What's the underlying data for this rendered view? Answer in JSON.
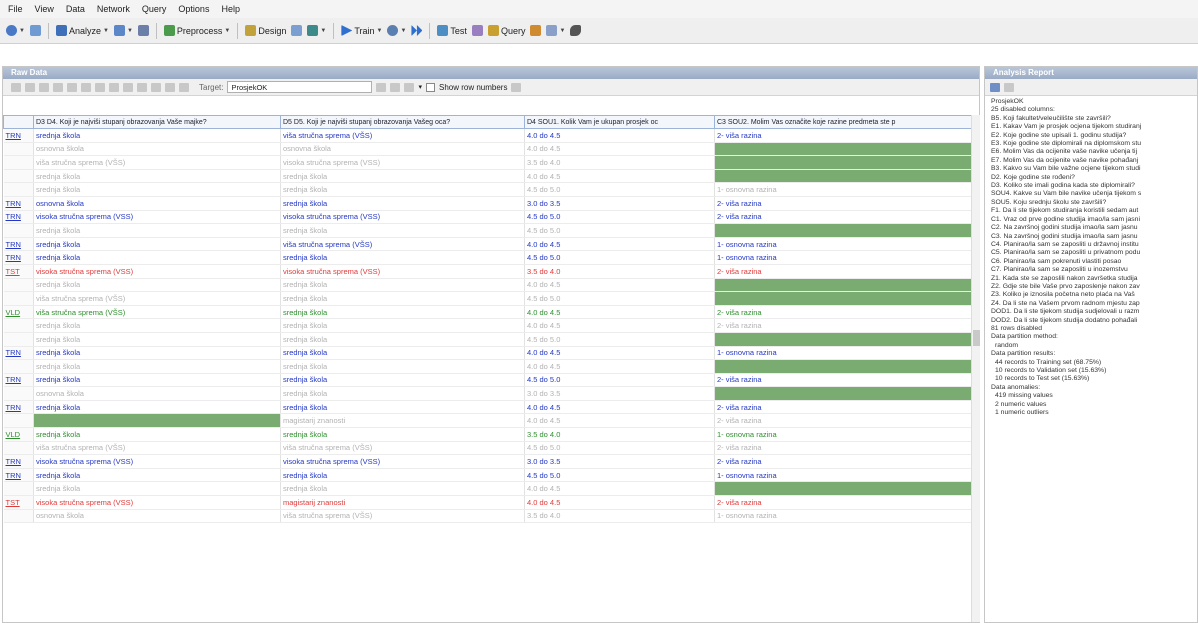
{
  "menu": [
    "File",
    "View",
    "Data",
    "Network",
    "Query",
    "Options",
    "Help"
  ],
  "toolbar": {
    "analyze": "Analyze",
    "preprocess": "Preprocess",
    "design": "Design",
    "train": "Train",
    "test": "Test",
    "query": "Query"
  },
  "raw_panel": {
    "title": "Raw Data",
    "target_label": "Target:",
    "target_value": "ProsjekOK",
    "show_row_numbers": "Show row numbers"
  },
  "columns": [
    "D3 D4. Koji je najviši stupanj obrazovanja Vaše majke?",
    "D5 D5. Koji je najviši stupanj obrazovanja Vašeg oca?",
    "D4 SOU1. Kolik Vam je ukupan prosjek oc",
    "C3 SOU2. Molim Vas označite koje razine predmeta ste p"
  ],
  "rows": [
    {
      "tag": "TRN",
      "style": "blue",
      "c": [
        "srednja škola",
        "viša stručna sprema (VŠS)",
        "4.0 do 4.5",
        "2- viša razina"
      ]
    },
    {
      "tag": "",
      "style": "gray",
      "c": [
        "osnovna škola",
        "osnovna škola",
        "4.0 do 4.5",
        ""
      ],
      "fill": [
        3
      ]
    },
    {
      "tag": "",
      "style": "gray",
      "c": [
        "viša stručna sprema (VŠS)",
        "visoka stručna sprema (VSS)",
        "3.5 do 4.0",
        ""
      ],
      "fill": [
        3
      ]
    },
    {
      "tag": "",
      "style": "gray",
      "c": [
        "srednja škola",
        "srednja škola",
        "4.0 do 4.5",
        ""
      ],
      "fill": [
        3
      ]
    },
    {
      "tag": "",
      "style": "gray",
      "c": [
        "srednja škola",
        "srednja škola",
        "4.5 do 5.0",
        "1- osnovna razina"
      ]
    },
    {
      "tag": "TRN",
      "style": "blue",
      "c": [
        "osnovna škola",
        "srednja škola",
        "3.0 do 3.5",
        "2- viša razina"
      ]
    },
    {
      "tag": "TRN",
      "style": "blue",
      "c": [
        "visoka stručna sprema (VSS)",
        "visoka stručna sprema (VSS)",
        "4.5 do 5.0",
        "2- viša razina"
      ]
    },
    {
      "tag": "",
      "style": "gray",
      "c": [
        "srednja škola",
        "srednja škola",
        "4.5 do 5.0",
        ""
      ],
      "fill": [
        3
      ]
    },
    {
      "tag": "TRN",
      "style": "blue",
      "c": [
        "srednja škola",
        "viša stručna sprema (VŠS)",
        "4.0 do 4.5",
        "1- osnovna razina"
      ]
    },
    {
      "tag": "TRN",
      "style": "blue",
      "c": [
        "srednja škola",
        "srednja škola",
        "4.5 do 5.0",
        "1- osnovna razina"
      ]
    },
    {
      "tag": "TST",
      "style": "red",
      "c": [
        "visoka stručna sprema (VSS)",
        "visoka stručna sprema (VSS)",
        "3.5 do 4.0",
        "2- viša razina"
      ]
    },
    {
      "tag": "",
      "style": "gray",
      "c": [
        "srednja škola",
        "srednja škola",
        "4.0 do 4.5",
        ""
      ],
      "fill": [
        3
      ]
    },
    {
      "tag": "",
      "style": "gray",
      "c": [
        "viša stručna sprema (VŠS)",
        "srednja škola",
        "4.5 do 5.0",
        ""
      ],
      "fill": [
        3
      ]
    },
    {
      "tag": "VLD",
      "style": "green",
      "c": [
        "viša stručna sprema (VŠS)",
        "srednja škola",
        "4.0 do 4.5",
        "2- viša razina"
      ]
    },
    {
      "tag": "",
      "style": "gray",
      "c": [
        "srednja škola",
        "srednja škola",
        "4.0 do 4.5",
        "2- viša razina"
      ]
    },
    {
      "tag": "",
      "style": "gray",
      "c": [
        "srednja škola",
        "srednja škola",
        "4.5 do 5.0",
        ""
      ],
      "fill": [
        3
      ]
    },
    {
      "tag": "TRN",
      "style": "blue",
      "c": [
        "srednja škola",
        "srednja škola",
        "4.0 do 4.5",
        "1- osnovna razina"
      ]
    },
    {
      "tag": "",
      "style": "gray",
      "c": [
        "srednja škola",
        "srednja škola",
        "4.0 do 4.5",
        ""
      ],
      "fill": [
        3
      ]
    },
    {
      "tag": "TRN",
      "style": "blue",
      "c": [
        "srednja škola",
        "srednja škola",
        "4.5 do 5.0",
        "2- viša razina"
      ]
    },
    {
      "tag": "",
      "style": "gray",
      "c": [
        "osnovna škola",
        "srednja škola",
        "3.0 do 3.5",
        ""
      ],
      "fill": [
        3
      ]
    },
    {
      "tag": "TRN",
      "style": "blue",
      "c": [
        "srednja škola",
        "srednja škola",
        "4.0 do 4.5",
        "2- viša razina"
      ]
    },
    {
      "tag": "",
      "style": "gray",
      "c": [
        "",
        "magistarij znanosti",
        "4.0 do 4.5",
        "2- viša razina"
      ],
      "fill": [
        0
      ]
    },
    {
      "tag": "VLD",
      "style": "green",
      "c": [
        "srednja škola",
        "srednja škola",
        "3.5 do 4.0",
        "1- osnovna razina"
      ]
    },
    {
      "tag": "",
      "style": "gray",
      "c": [
        "viša stručna sprema (VŠS)",
        "viša stručna sprema (VŠS)",
        "4.5 do 5.0",
        "2- viša razina"
      ]
    },
    {
      "tag": "TRN",
      "style": "blue",
      "c": [
        "visoka stručna sprema (VSS)",
        "visoka stručna sprema (VSS)",
        "3.0 do 3.5",
        "2- viša razina"
      ]
    },
    {
      "tag": "TRN",
      "style": "blue",
      "c": [
        "srednja škola",
        "srednja škola",
        "4.5 do 5.0",
        "1- osnovna razina"
      ]
    },
    {
      "tag": "",
      "style": "gray",
      "c": [
        "srednja škola",
        "srednja škola",
        "4.0 do 4.5",
        ""
      ],
      "fill": [
        3
      ]
    },
    {
      "tag": "TST",
      "style": "red",
      "c": [
        "visoka stručna sprema (VSS)",
        "magistarij znanosti",
        "4.0 do 4.5",
        "2- viša razina"
      ]
    },
    {
      "tag": "",
      "style": "gray",
      "c": [
        "osnovna škola",
        "viša stručna sprema (VŠS)",
        "3.5 do 4.0",
        "1- osnovna razina"
      ]
    }
  ],
  "report": {
    "title": "Analysis Report",
    "lines": [
      "ProsjekOK",
      "25 disabled columns:",
      "B5. Koji fakultet/veleučilište ste završili?",
      "E1. Kakav Vam je prosjek ocjena tijekom studiranj",
      "E2. Koje godine ste upisali 1. godinu studija?",
      "E3. Koje godine ste diplomirali na diplomskom stu",
      "E6. Molim Vas da ocijenite vaše navike učenja tij",
      "E7. Molim Vas da ocijenite vaše navike pohađanj",
      "B3. Kakvo su Vam bile važne ocjene tijekom studi",
      "D2. Koje godine ste rođeni?",
      "D3. Koliko ste imali godina kada ste diplomirali?",
      "SOU4. Kakve su Vam bile navike učenja tijekom s",
      "SOU5. Koju srednju školu ste završili?",
      "F1. Da li ste tijekom studiranja koristili sedam aut",
      "C1. Vraz od prve godine studija imao/la sam jasni",
      "C2. Na završnoj godini studija imao/la sam jasnu",
      "C3. Na završnoj godini studija imao/la sam jasnu",
      "C4. Planirao/la sam se zaposliti u državnoj institu",
      "C5. Planirao/la sam se zaposliti u privatnom podu",
      "C6. Planirao/la sam pokrenuti vlastiti posao",
      "C7. Planirao/la sam se zaposliti u inozemstvu",
      "Z1. Kada ste se zaposlili nakon završetka studija",
      "Z2. Gdje ste bile Vaše prvo zaposlenje nakon zav",
      "Z3. Koliko je iznosila početna neto plaća na Vaš",
      "Z4. Da li ste na Vašem prvom radnom mjestu zap",
      "DOD1. Da li ste tijekom studija sudjelovali u razm",
      "DOD2. Da li ste tijekom studija dodatno pohađali",
      "81 rows disabled",
      "Data partition method:",
      "random",
      "Data partition results:",
      "44 records to Training set (68.75%)",
      "10 records to Validation set (15.63%)",
      "10 records to Test set (15.63%)",
      "Data anomalies:",
      "419 missing values",
      "2 numeric values",
      "1 numeric outliers"
    ]
  }
}
